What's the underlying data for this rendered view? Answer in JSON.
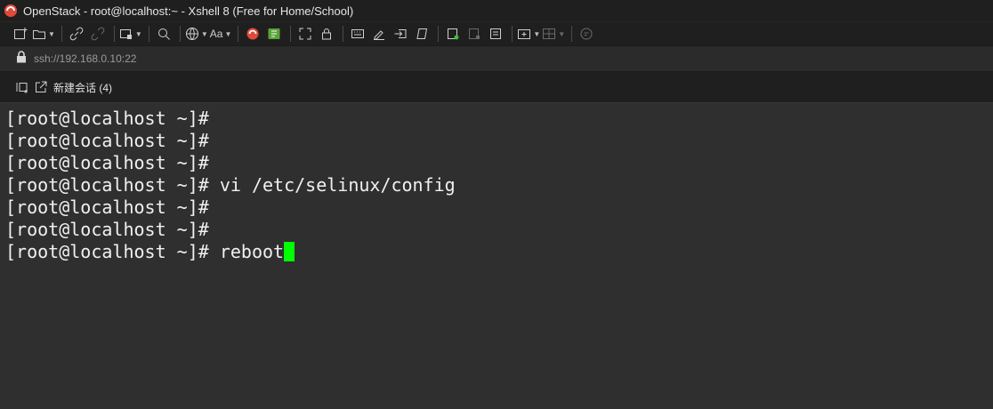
{
  "window": {
    "title": "OpenStack - root@localhost:~ - Xshell 8 (Free for Home/School)"
  },
  "address": {
    "url": "ssh://192.168.0.10:22"
  },
  "tabbar": {
    "new_session_label": "新建会话 (4)"
  },
  "toolbar": {
    "font_label": "Aa"
  },
  "terminal": {
    "prompt": "[root@localhost ~]#",
    "lines": [
      {
        "command": ""
      },
      {
        "command": ""
      },
      {
        "command": ""
      },
      {
        "command": " vi /etc/selinux/config"
      },
      {
        "command": ""
      },
      {
        "command": ""
      },
      {
        "command": " reboot"
      }
    ],
    "cursor_color": "#00ff00"
  },
  "icons": {
    "app": "xshell-icon",
    "lock": "lock-icon"
  }
}
